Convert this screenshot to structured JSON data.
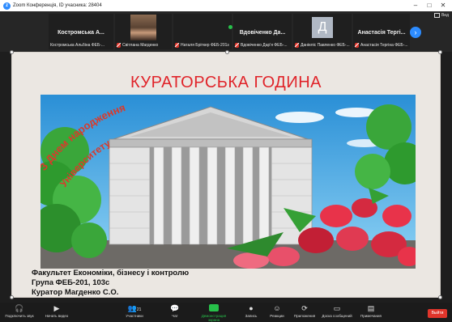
{
  "window": {
    "title": "Zoom Конференція, ID учасника: 28404"
  },
  "participants": [
    {
      "name": "Костромська А...",
      "footer": "Костромська Альбіна ФЕБ-...",
      "muted": false
    },
    {
      "name": "",
      "footer": "Світлана Магденко",
      "muted": true
    },
    {
      "name": "",
      "footer": "Наталя Бріткер ФЕБ-201з",
      "muted": true
    },
    {
      "name": "Вдовіченко Да...",
      "footer": "Вдовіченко Дар'я ФЕБ-...",
      "muted": true
    },
    {
      "name": "",
      "avatar_letter": "Д",
      "footer": "Даніеліс Павленко ФЕБ-...",
      "muted": true
    },
    {
      "name": "Анастасія Тергі...",
      "footer": "Анастасія Тергіна ФЕБ-...",
      "muted": true
    }
  ],
  "view_label": "Вид",
  "slide": {
    "title": "КУРАТОРСЬКА ГОДИНА",
    "arc_text": "З Днем народження",
    "arc_text_2": "Університету",
    "faculty_prefix": "Факультет ",
    "faculty_name": "Економіки, бізнесу і контролю",
    "group": "Група ФЕБ-201,  103с",
    "curator": "Куратор Магденко С.О."
  },
  "toolbar": {
    "items": [
      {
        "label": "Подключить звук",
        "icon": "headphones-icon"
      },
      {
        "label": "Начать видео",
        "icon": "video-off-icon"
      },
      {
        "label": "Участники",
        "icon": "participants-icon",
        "count": "21"
      },
      {
        "label": "Чат",
        "icon": "chat-icon"
      },
      {
        "label": "Демонстрация экрана",
        "icon": "share-screen-icon"
      },
      {
        "label": "Запись",
        "icon": "record-icon"
      },
      {
        "label": "Реакции",
        "icon": "reactions-icon"
      },
      {
        "label": "Приложения",
        "icon": "apps-icon"
      },
      {
        "label": "Доска сообщений",
        "icon": "whiteboard-icon"
      },
      {
        "label": "Примечания",
        "icon": "notes-icon"
      }
    ],
    "end_label": "Выйти"
  },
  "colors": {
    "accent": "#2d8cff",
    "title_red": "#e0242a",
    "share_green": "#27c04a",
    "end_red": "#e0352b"
  }
}
